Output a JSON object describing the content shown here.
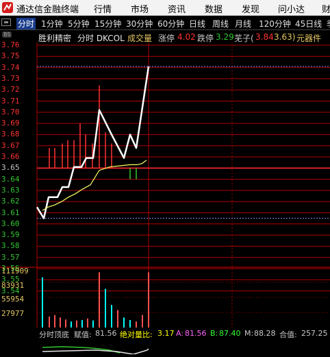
{
  "titlebar": {
    "title": "通达信金融终端",
    "menus": [
      "行情",
      "市场",
      "资讯",
      "数据",
      "发现",
      "问小达",
      "财"
    ]
  },
  "toolbar": {
    "periods": [
      "分时",
      "1分钟",
      "5分钟",
      "15分钟",
      "30分钟",
      "60分钟",
      "日线",
      "周线",
      "月线",
      "120分钟",
      "45日线",
      "季"
    ],
    "active": "分时"
  },
  "infobar": {
    "badge": "BS",
    "stock": "胜利精密",
    "mode": "分时 DKCOL",
    "volume_label": "成交量",
    "limit_up_label": "涨停",
    "limit_up": "4.02",
    "limit_down_label": "跌停",
    "limit_down": "3.29",
    "dragon_label": "芜子(",
    "dragon_a": "3.84",
    "dragon_b": "3.63)",
    "sector": "元器件"
  },
  "price_axis": [
    "3.76",
    "3.75",
    "3.74",
    "3.73",
    "3.72",
    "3.71",
    "3.70",
    "3.69",
    "3.68",
    "3.67",
    "3.66",
    "3.65",
    "3.64",
    "3.63",
    "3.62",
    "3.61",
    "3.60",
    "3.59",
    "3.58",
    "3.57",
    "3.56",
    "3.55",
    "3.54"
  ],
  "volume_axis": [
    "111909",
    "83931",
    "55954",
    "27977"
  ],
  "bottombar": {
    "name": "分时顶底",
    "fuzhi_label": "赋值:",
    "fuzhi": "81.56",
    "jdl_label": "绝对量比:",
    "jdl": "3.17",
    "a_label": "A:",
    "a": "81.56",
    "b_label": "B:",
    "b": "87.40",
    "m_label": "M:",
    "m": "88.28",
    "hz_label": "合值:",
    "hz": "257.25"
  },
  "colors": {
    "bg": "#000000",
    "grid": "#b00000",
    "up": "#ff3232",
    "down": "#32c832",
    "price_line": "#ffffff",
    "avg_line": "#ffff64",
    "axis_red": "#ff3232",
    "axis_green": "#32c832",
    "neutral": "#c8c8c8",
    "volume_cyan": "#00ffff",
    "volume_red": "#ff5050"
  },
  "chart_data": {
    "type": "line",
    "series": [
      {
        "name": "price",
        "values": [
          3.615,
          3.605,
          3.624,
          3.624,
          3.633,
          3.633,
          3.651,
          3.651,
          3.659,
          3.659,
          3.702,
          3.68,
          3.659,
          3.68,
          3.668,
          3.741
        ]
      },
      {
        "name": "avg",
        "values": [
          3.612,
          3.615,
          3.617,
          3.62,
          3.624,
          3.627,
          3.631,
          3.635,
          3.648,
          3.651,
          3.652,
          3.653,
          3.653,
          3.654,
          3.657
        ]
      }
    ],
    "indicator_bars_up": [
      3.668,
      3.668,
      3.672,
      3.675,
      3.675,
      3.69,
      3.68,
      3.672,
      3.724,
      3.682,
      3.672
    ],
    "indicator_bars_down": [
      3.64,
      3.64
    ],
    "volume_values": [
      100000,
      22000,
      25000,
      20000,
      16000,
      12000,
      14000,
      15000,
      18000,
      14000,
      110000,
      77000,
      45000,
      35000,
      20000,
      15000,
      12000,
      25000,
      110000
    ],
    "volume_colors": [
      "cyan",
      "red",
      "red",
      "red",
      "red",
      "cyan",
      "red",
      "cyan",
      "red",
      "cyan",
      "red",
      "cyan",
      "cyan",
      "red",
      "cyan",
      "cyan",
      "red",
      "red",
      "red"
    ],
    "ylim": [
      3.54,
      3.76
    ],
    "volume_ylim": [
      0,
      111909
    ],
    "reference_price": 3.65,
    "grid": true
  }
}
